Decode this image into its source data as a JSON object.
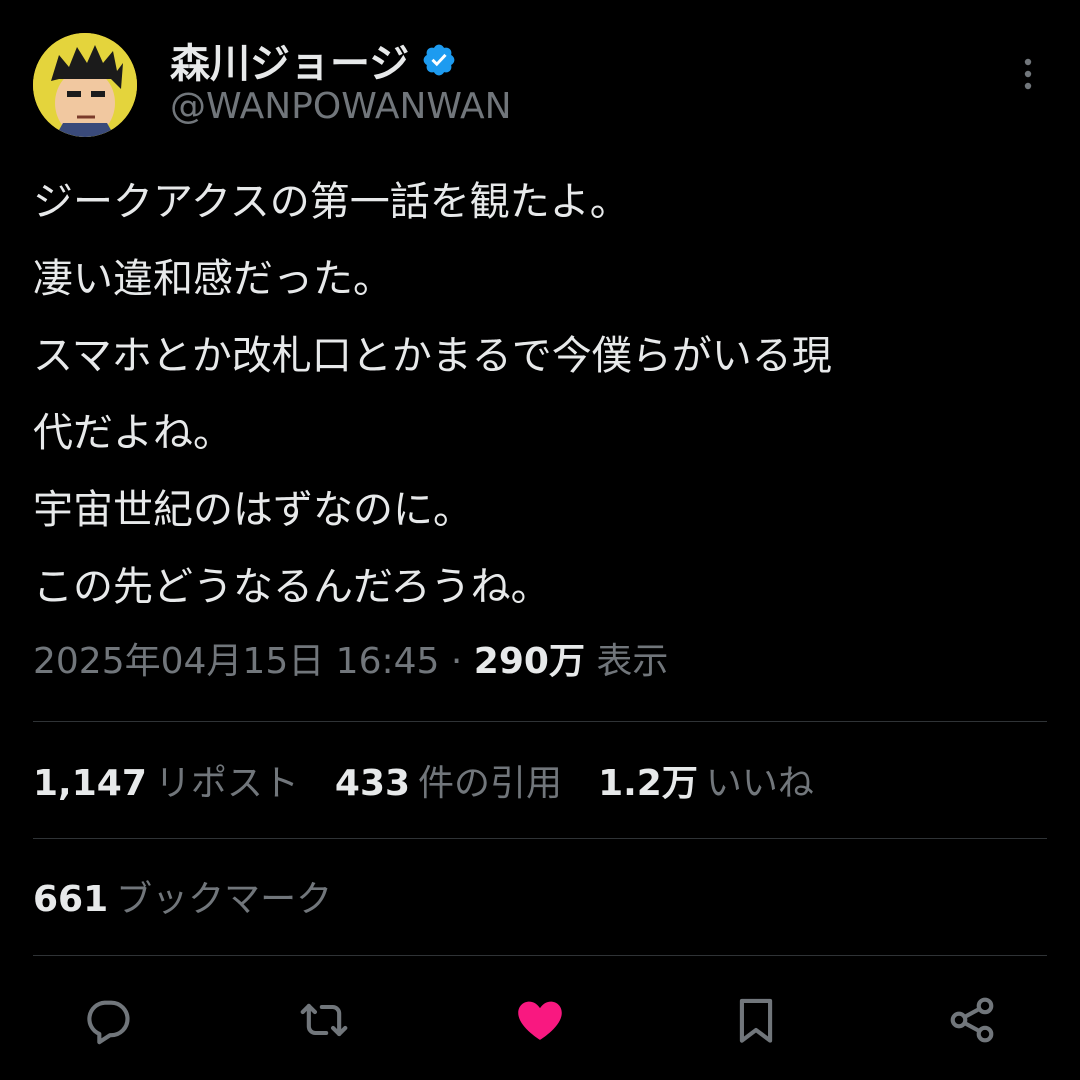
{
  "author": {
    "display_name": "森川ジョージ",
    "handle": "@WANPOWANWAN",
    "verified_icon": "verified-badge-icon",
    "avatar_icon": "avatar"
  },
  "tweet": {
    "lines": [
      "ジークアクスの第一話を観たよ。",
      "凄い違和感だった。",
      "スマホとか改札口とかまるで今僕らがいる現",
      "代だよね。",
      "宇宙世紀のはずなのに。",
      "この先どうなるんだろうね。"
    ]
  },
  "meta": {
    "timestamp": "2025年04月15日 16:45",
    "separator": "·",
    "views_count": "290万",
    "views_label": "表示"
  },
  "stats": {
    "reposts_count": "1,147",
    "reposts_label": "リポスト",
    "quotes_count": "433",
    "quotes_label": "件の引用",
    "likes_count": "1.2万",
    "likes_label": "いいね"
  },
  "bookmarks": {
    "count": "661",
    "label": "ブックマーク"
  },
  "actions": {
    "reply_icon": "reply-icon",
    "repost_icon": "repost-icon",
    "like_icon": "like-icon",
    "bookmark_icon": "bookmark-icon",
    "share_icon": "share-icon"
  },
  "colors": {
    "background": "#000000",
    "text_primary": "#e7e9ea",
    "text_secondary": "#71767b",
    "divider": "#2f3336",
    "verified_blue": "#1d9bf0",
    "like_pink": "#f91880"
  }
}
